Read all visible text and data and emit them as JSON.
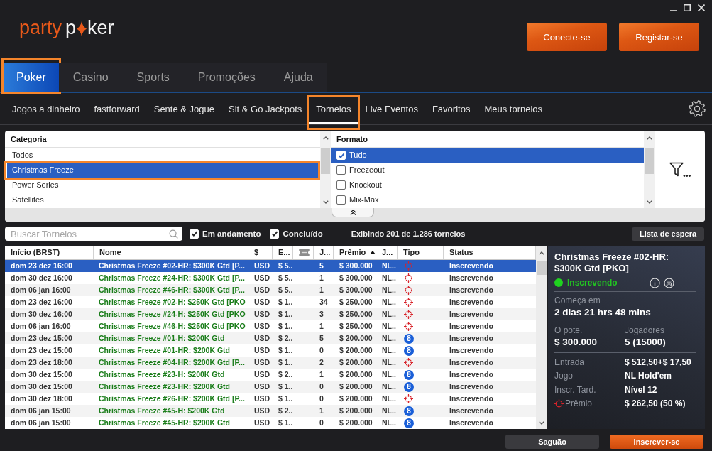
{
  "logo": {
    "part_1": "party",
    "part_2": "p",
    "part_3": "ker"
  },
  "header_buttons": [
    {
      "label": "Conecte-se"
    },
    {
      "label": "Registar-se"
    }
  ],
  "main_tabs": [
    {
      "label": "Poker",
      "selected": true,
      "highlighted": true
    },
    {
      "label": "Casino",
      "selected": false,
      "highlighted": false
    },
    {
      "label": "Sports",
      "selected": false,
      "highlighted": false
    },
    {
      "label": "Promoções",
      "selected": false,
      "highlighted": false
    },
    {
      "label": "Ajuda",
      "selected": false,
      "highlighted": false
    }
  ],
  "sub_tabs": [
    {
      "label": "Jogos a dinheiro",
      "selected": false,
      "highlighted": false
    },
    {
      "label": "fastforward",
      "selected": false,
      "highlighted": false
    },
    {
      "label": "Sente & Jogue",
      "selected": false,
      "highlighted": false
    },
    {
      "label": "Sit & Go Jackpots",
      "selected": false,
      "highlighted": false
    },
    {
      "label": "Torneios",
      "selected": true,
      "highlighted": true
    },
    {
      "label": "Live Eventos",
      "selected": false,
      "highlighted": false
    },
    {
      "label": "Favoritos",
      "selected": false,
      "highlighted": false
    },
    {
      "label": "Meus torneios",
      "selected": false,
      "highlighted": false
    }
  ],
  "filters": {
    "category": {
      "title": "Categoria",
      "items": [
        {
          "label": "Todos",
          "selected": false,
          "highlighted": false
        },
        {
          "label": "Christmas Freeze",
          "selected": true,
          "highlighted": true
        },
        {
          "label": "Power Series",
          "selected": false,
          "highlighted": false
        },
        {
          "label": "Satellites",
          "selected": false,
          "highlighted": false
        }
      ]
    },
    "format": {
      "title": "Formato",
      "items": [
        {
          "label": "Tudo",
          "checked": true,
          "selected": true
        },
        {
          "label": "Freezeout",
          "checked": false,
          "selected": false
        },
        {
          "label": "Knockout",
          "checked": false,
          "selected": false
        },
        {
          "label": "Mix-Max",
          "checked": false,
          "selected": false
        }
      ]
    }
  },
  "search": {
    "placeholder": "Buscar Torneios"
  },
  "toggles": [
    {
      "label": "Em andamento",
      "checked": true
    },
    {
      "label": "Concluído",
      "checked": true
    }
  ],
  "result_count": "Exibindo 201 de 1.286 torneios",
  "waitlist_button": "Lista de espera",
  "table": {
    "columns": [
      {
        "kind": "text",
        "label": "Início (BRST)",
        "sorted": false
      },
      {
        "kind": "text",
        "label": "Nome",
        "sorted": false
      },
      {
        "kind": "text",
        "label": "$",
        "sorted": false
      },
      {
        "kind": "text",
        "label": "E...",
        "sorted": false
      },
      {
        "kind": "icon",
        "sorted": false
      },
      {
        "kind": "text",
        "label": "J...",
        "sorted": false
      },
      {
        "kind": "text",
        "label": "Prêmio",
        "sorted": true
      },
      {
        "kind": "text",
        "label": "J...",
        "sorted": false
      },
      {
        "kind": "text",
        "label": "Tipo",
        "sorted": false
      },
      {
        "kind": "text",
        "label": "Status",
        "sorted": false
      }
    ],
    "rows": [
      {
        "start": "dom 23 dez 16:00",
        "name": "Christmas Freeze #02-HR: $300K Gtd [P...",
        "currency": "USD",
        "entry": "$ 5..",
        "players": "5",
        "prize": "$ 300.000",
        "game": "NL..",
        "type": {
          "kind": "target"
        },
        "status": "Inscrevendo",
        "selected": true
      },
      {
        "start": "dom 30 dez 16:00",
        "name": "Christmas Freeze #24-HR: $300K Gtd [P...",
        "currency": "USD",
        "entry": "$ 5..",
        "players": "1",
        "prize": "$ 300.000",
        "game": "NL..",
        "type": {
          "kind": "target"
        },
        "status": "Inscrevendo",
        "selected": false
      },
      {
        "start": "dom 06 jan 16:00",
        "name": "Christmas Freeze #46-HR: $300K Gtd [P...",
        "currency": "USD",
        "entry": "$ 5..",
        "players": "1",
        "prize": "$ 300.000",
        "game": "NL..",
        "type": {
          "kind": "target"
        },
        "status": "Inscrevendo",
        "selected": false
      },
      {
        "start": "dom 23 dez 16:00",
        "name": "Christmas Freeze #02-H: $250K Gtd [PKO",
        "currency": "USD",
        "entry": "$ 1..",
        "players": "34",
        "prize": "$ 250.000",
        "game": "NL..",
        "type": {
          "kind": "target"
        },
        "status": "Inscrevendo",
        "selected": false
      },
      {
        "start": "dom 30 dez 16:00",
        "name": "Christmas Freeze #24-H: $250K Gtd [PKO",
        "currency": "USD",
        "entry": "$ 1..",
        "players": "3",
        "prize": "$ 250.000",
        "game": "NL..",
        "type": {
          "kind": "target"
        },
        "status": "Inscrevendo",
        "selected": false
      },
      {
        "start": "dom 06 jan 16:00",
        "name": "Christmas Freeze #46-H: $250K Gtd [PKO",
        "currency": "USD",
        "entry": "$ 1..",
        "players": "1",
        "prize": "$ 250.000",
        "game": "NL..",
        "type": {
          "kind": "target"
        },
        "status": "Inscrevendo",
        "selected": false
      },
      {
        "start": "dom 23 dez 15:00",
        "name": "Christmas Freeze #01-H: $200K Gtd",
        "currency": "USD",
        "entry": "$ 2..",
        "players": "5",
        "prize": "$ 200.000",
        "game": "NL..",
        "type": {
          "kind": "badge",
          "text": "8"
        },
        "status": "Inscrevendo",
        "selected": false
      },
      {
        "start": "dom 23 dez 15:00",
        "name": "Christmas Freeze #01-HR: $200K Gtd",
        "currency": "USD",
        "entry": "$ 1..",
        "players": "0",
        "prize": "$ 200.000",
        "game": "NL..",
        "type": {
          "kind": "badge",
          "text": "8"
        },
        "status": "Inscrevendo",
        "selected": false
      },
      {
        "start": "dom 23 dez 18:00",
        "name": "Christmas Freeze #04-HR: $200K Gtd [P...",
        "currency": "USD",
        "entry": "$ 1..",
        "players": "2",
        "prize": "$ 200.000",
        "game": "NL..",
        "type": {
          "kind": "target"
        },
        "status": "Inscrevendo",
        "selected": false
      },
      {
        "start": "dom 30 dez 15:00",
        "name": "Christmas Freeze #23-H: $200K Gtd",
        "currency": "USD",
        "entry": "$ 2..",
        "players": "1",
        "prize": "$ 200.000",
        "game": "NL..",
        "type": {
          "kind": "badge",
          "text": "8"
        },
        "status": "Inscrevendo",
        "selected": false
      },
      {
        "start": "dom 30 dez 15:00",
        "name": "Christmas Freeze #23-HR: $200K Gtd",
        "currency": "USD",
        "entry": "$ 1..",
        "players": "0",
        "prize": "$ 200.000",
        "game": "NL..",
        "type": {
          "kind": "badge",
          "text": "8"
        },
        "status": "Inscrevendo",
        "selected": false
      },
      {
        "start": "dom 30 dez 18:00",
        "name": "Christmas Freeze #26-HR: $200K Gtd [P...",
        "currency": "USD",
        "entry": "$ 1..",
        "players": "0",
        "prize": "$ 200.000",
        "game": "NL..",
        "type": {
          "kind": "target"
        },
        "status": "Inscrevendo",
        "selected": false
      },
      {
        "start": "dom 06 jan 15:00",
        "name": "Christmas Freeze #45-H: $200K Gtd",
        "currency": "USD",
        "entry": "$ 2..",
        "players": "1",
        "prize": "$ 200.000",
        "game": "NL..",
        "type": {
          "kind": "badge",
          "text": "8"
        },
        "status": "Inscrevendo",
        "selected": false
      },
      {
        "start": "dom 06 jan 15:00",
        "name": "Christmas Freeze #45-HR: $200K Gtd",
        "currency": "USD",
        "entry": "$ 1..",
        "players": "0",
        "prize": "$ 200.000",
        "game": "NL..",
        "type": {
          "kind": "badge",
          "text": "8"
        },
        "status": "Inscrevendo",
        "selected": false
      }
    ]
  },
  "details": {
    "title": "Christmas Freeze #02-HR: $300K Gtd [PKO]",
    "status": "Inscrevendo",
    "starts_label": "Começa em",
    "starts_value": "2 dias 21 hrs 48 mins",
    "stats": [
      {
        "label": "O pote.",
        "value": "$ 300.000"
      },
      {
        "label": "Jogadores",
        "value": "5 (15000)"
      }
    ],
    "info": [
      {
        "kind": "plain",
        "label": "Entrada",
        "value": "$ 512,50+$ 17,50"
      },
      {
        "kind": "plain",
        "label": "Jogo",
        "value": "NL Hold'em"
      },
      {
        "kind": "plain",
        "label": "Inscr. Tard.",
        "value": "Nível 12"
      },
      {
        "kind": "bounty",
        "label": "Prêmio",
        "value": "$ 262,50 (50 %)"
      }
    ]
  },
  "footer_buttons": [
    {
      "label": "Saguão",
      "kind": "secondary"
    },
    {
      "label": "Inscrever-se",
      "kind": "primary"
    }
  ]
}
